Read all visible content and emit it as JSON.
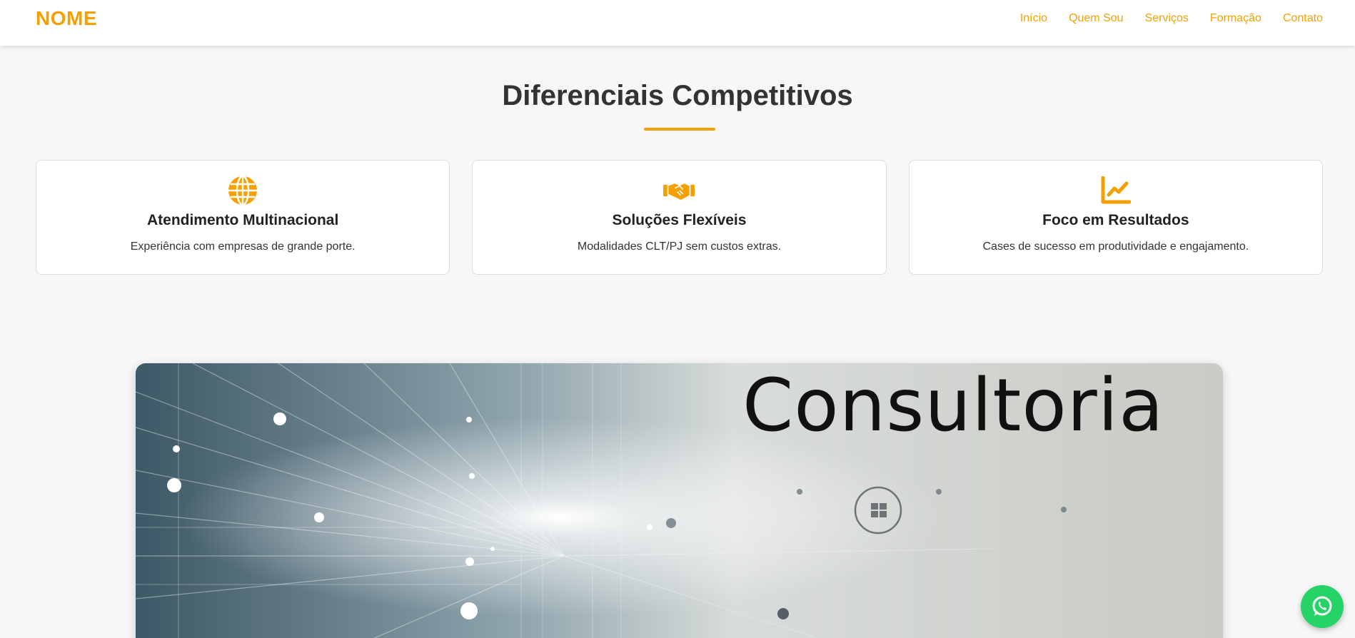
{
  "header": {
    "logo": "NOME",
    "nav": [
      "Início",
      "Quem Sou",
      "Serviços",
      "Formação",
      "Contato"
    ]
  },
  "section": {
    "title": "Diferenciais Competitivos",
    "cards": [
      {
        "icon": "globe-icon",
        "title": "Atendimento Multinacional",
        "text": "Experiência com empresas de grande porte."
      },
      {
        "icon": "handshake-icon",
        "title": "Soluções Flexíveis",
        "text": "Modalidades CLT/PJ sem custos extras."
      },
      {
        "icon": "chart-line-icon",
        "title": "Foco em Resultados",
        "text": "Cases de sucesso em produtividade e engajamento."
      }
    ]
  },
  "banner": {
    "text": "Consultoria"
  },
  "colors": {
    "accent": "#f5a000",
    "whatsapp": "#25d366"
  }
}
